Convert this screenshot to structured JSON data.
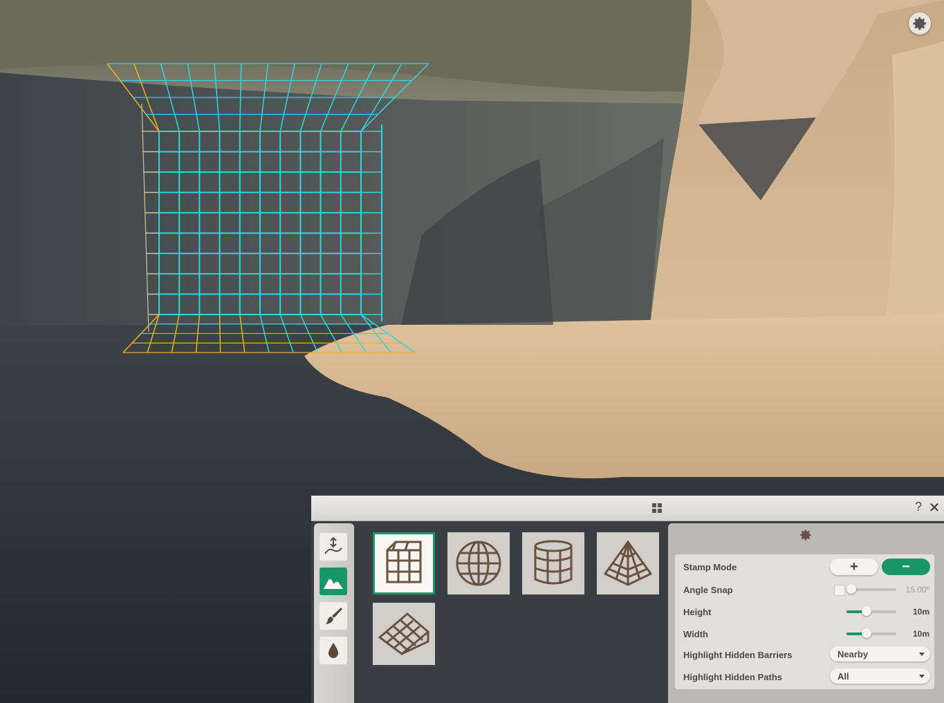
{
  "panel": {
    "help_label": "?",
    "close_label": "✕"
  },
  "toolbar": {
    "tools": [
      {
        "icon": "height-brush-icon"
      },
      {
        "icon": "terrain-stamp-icon",
        "active": true
      },
      {
        "icon": "paint-brush-icon"
      },
      {
        "icon": "water-drop-icon"
      }
    ]
  },
  "stamps": [
    {
      "icon": "box-stamp-icon",
      "selected": true
    },
    {
      "icon": "sphere-stamp-icon"
    },
    {
      "icon": "cylinder-stamp-icon"
    },
    {
      "icon": "pyramid-stamp-icon"
    },
    {
      "icon": "ramp-stamp-icon"
    }
  ],
  "options": {
    "stamp_mode": {
      "label": "Stamp Mode",
      "plus": "+",
      "minus": "−",
      "selected": "minus"
    },
    "angle_snap": {
      "label": "Angle Snap",
      "value": "15.00º",
      "enabled": false,
      "level": 0
    },
    "height": {
      "label": "Height",
      "value": "10m",
      "level": 0.4
    },
    "width": {
      "label": "Width",
      "value": "10m",
      "level": 0.4
    },
    "highlight_barriers": {
      "label": "Highlight Hidden Barriers",
      "value": "Nearby"
    },
    "highlight_paths": {
      "label": "Highlight Hidden Paths",
      "value": "All"
    }
  },
  "colors": {
    "accent": "#1b9468",
    "grid_cyan": "#2fd6e0",
    "grid_orange": "#f0b020"
  }
}
